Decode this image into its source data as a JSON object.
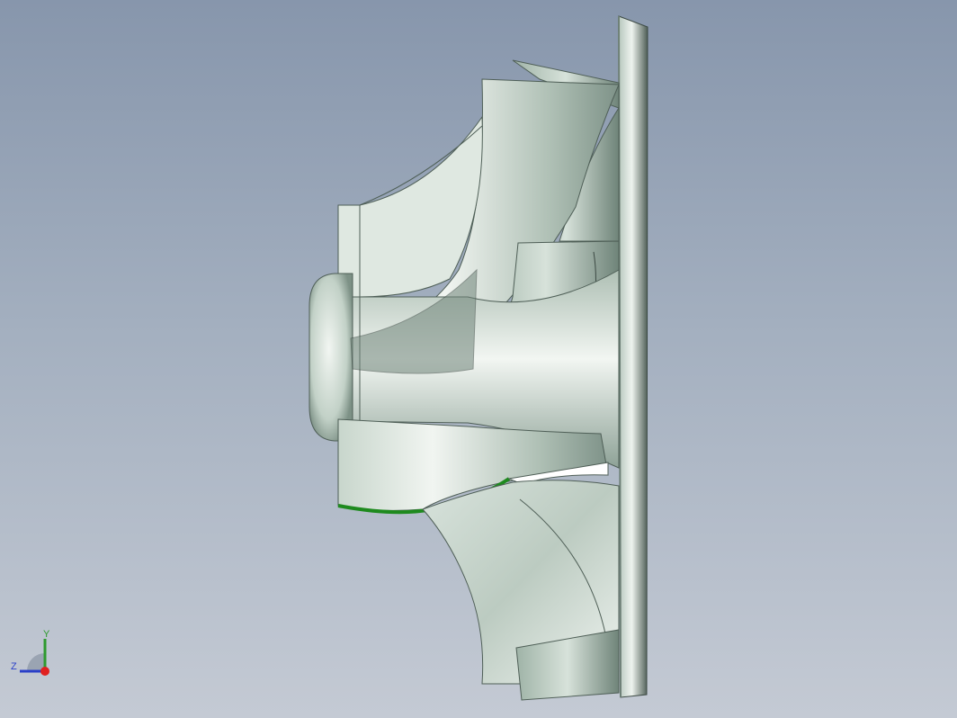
{
  "viewport": {
    "background_top": "#8796ac",
    "background_bottom": "#c4cad4"
  },
  "model": {
    "part": "impeller",
    "body_color": "#dbe4dd",
    "shadow_color": "#5f7268",
    "selected_edge_color": "#1e8a1e"
  },
  "triad": {
    "y_label": "Y",
    "z_label": "Z",
    "y_color": "#2e9a2e",
    "z_color": "#2a3fc8",
    "x_color": "#e02020"
  }
}
